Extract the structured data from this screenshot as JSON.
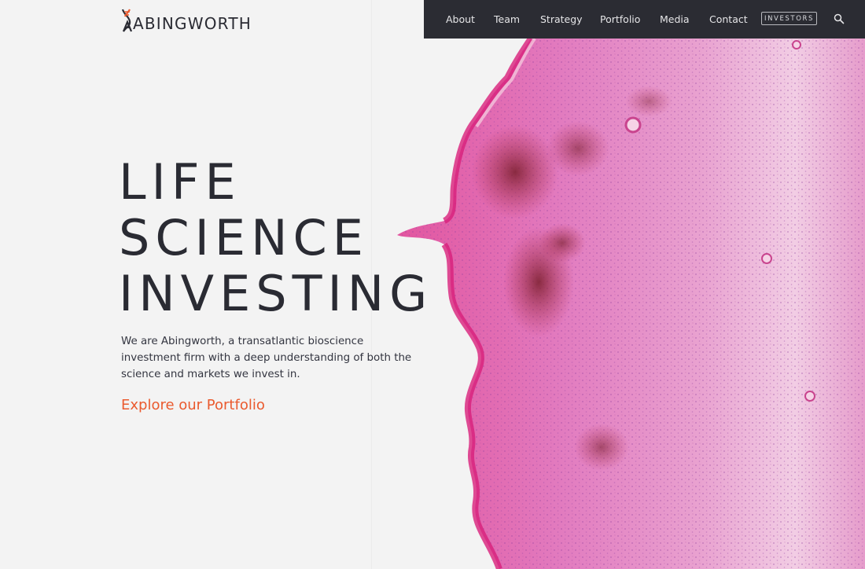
{
  "brand": {
    "name": "ABINGWORTH",
    "logo_icon": "dna-helix-icon",
    "accent_color": "#ea5a2e",
    "dark_color": "#2b2c33"
  },
  "nav": {
    "items": [
      {
        "label": "About"
      },
      {
        "label": "Team"
      },
      {
        "label": "Strategy"
      },
      {
        "label": "Portfolio"
      },
      {
        "label": "Media"
      },
      {
        "label": "Contact"
      }
    ],
    "investors_label": "INVESTORS",
    "search_icon": "search-icon"
  },
  "hero": {
    "headline_lines": [
      "LIFE",
      "SCIENCE",
      "INVESTING"
    ],
    "intro": "We are Abingworth, a transatlantic bioscience investment firm with a deep understanding of both the science and markets we invest in.",
    "cta_label": "Explore our Portfolio",
    "image_alt": "histology-tissue-image"
  }
}
